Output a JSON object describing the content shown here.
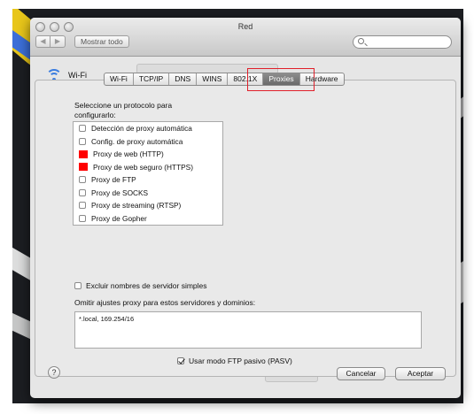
{
  "window": {
    "title": "Red",
    "show_all_label": "Mostrar todo",
    "search_placeholder": ""
  },
  "network": {
    "service_name": "Wi-Fi"
  },
  "tabs": [
    {
      "label": "Wi-Fi"
    },
    {
      "label": "TCP/IP"
    },
    {
      "label": "DNS"
    },
    {
      "label": "WINS"
    },
    {
      "label": "802.1X"
    },
    {
      "label": "Proxies",
      "active": true
    },
    {
      "label": "Hardware"
    }
  ],
  "proxies": {
    "section_label_line1": "Seleccione un protocolo para",
    "section_label_line2": "configurarlo:",
    "protocols": [
      {
        "label": "Detección de proxy automática",
        "checked": false,
        "highlight": false
      },
      {
        "label": "Config. de proxy automática",
        "checked": false,
        "highlight": false
      },
      {
        "label": "Proxy de web (HTTP)",
        "checked": false,
        "highlight": true
      },
      {
        "label": "Proxy de web seguro (HTTPS)",
        "checked": false,
        "highlight": true
      },
      {
        "label": "Proxy de FTP",
        "checked": false,
        "highlight": false
      },
      {
        "label": "Proxy de SOCKS",
        "checked": false,
        "highlight": false
      },
      {
        "label": "Proxy de streaming (RTSP)",
        "checked": false,
        "highlight": false
      },
      {
        "label": "Proxy de Gopher",
        "checked": false,
        "highlight": false
      }
    ],
    "exclude_simple_label": "Excluir nombres de servidor simples",
    "bypass_label": "Omitir ajustes proxy para estos servidores y dominios:",
    "bypass_value": "*.local, 169.254/16",
    "passive_ftp_label": "Usar modo FTP pasivo (PASV)",
    "passive_ftp_checked": true
  },
  "buttons": {
    "help": "?",
    "cancel": "Cancelar",
    "ok": "Aceptar"
  },
  "colors": {
    "highlight_red": "#ff0000",
    "annotation_box": "#e0202a",
    "wifi_blue": "#3b7de0"
  }
}
